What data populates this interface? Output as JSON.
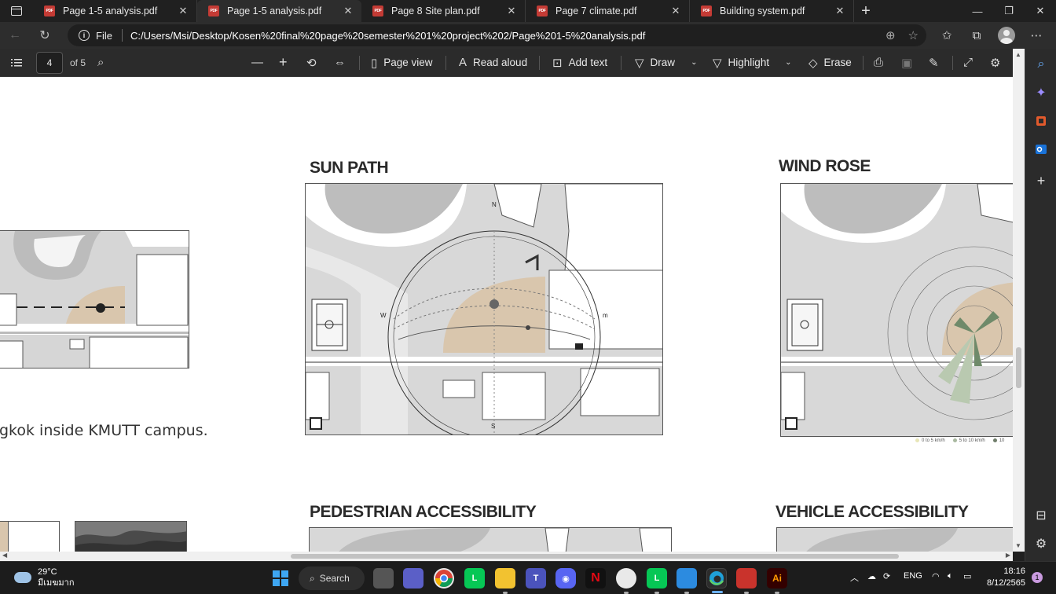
{
  "tabs": [
    {
      "title": "Page 1-5 analysis.pdf",
      "active": false
    },
    {
      "title": "Page 1-5 analysis.pdf",
      "active": true
    },
    {
      "title": "Page 8 Site plan.pdf",
      "active": false
    },
    {
      "title": "Page 7 climate.pdf",
      "active": false
    },
    {
      "title": "Building system.pdf",
      "active": false
    }
  ],
  "pdf_icon_label": "PDF",
  "address": {
    "file_label": "File",
    "url": "C:/Users/Msi/Desktop/Kosen%20final%20page%20semester%201%20project%202/Page%201-5%20analysis.pdf"
  },
  "pdf_toolbar": {
    "page_current": "4",
    "page_total": "of 5",
    "page_view": "Page view",
    "read_aloud": "Read aloud",
    "add_text": "Add text",
    "draw": "Draw",
    "highlight": "Highlight",
    "erase": "Erase"
  },
  "document": {
    "sun_path_title": "SUN PATH",
    "wind_rose_title": "WIND ROSE",
    "pedestrian_title": "PEDESTRIAN ACCESSIBILITY",
    "vehicle_title": "VEHICLE ACCESSIBILITY",
    "left_text": "gkok inside KMUTT campus.",
    "compass": {
      "n": "N",
      "s": "S",
      "w": "W",
      "e": "m"
    },
    "wind_legend": [
      "0 to 5 km/h",
      "5 to 10 km/h",
      "10"
    ]
  },
  "taskbar": {
    "temperature": "29°C",
    "weather_desc": "มีเมฆมาก",
    "search_label": "Search",
    "language": "ENG",
    "time": "18:16",
    "date": "8/12/2565",
    "notification_count": "1"
  },
  "colors": {
    "chrome_bg": "#202020",
    "tab_active": "#2d2d2d",
    "toolbar": "#2b2b2b",
    "site_fill": "#d9c6ad",
    "map_gray": "#d8d8d8"
  }
}
